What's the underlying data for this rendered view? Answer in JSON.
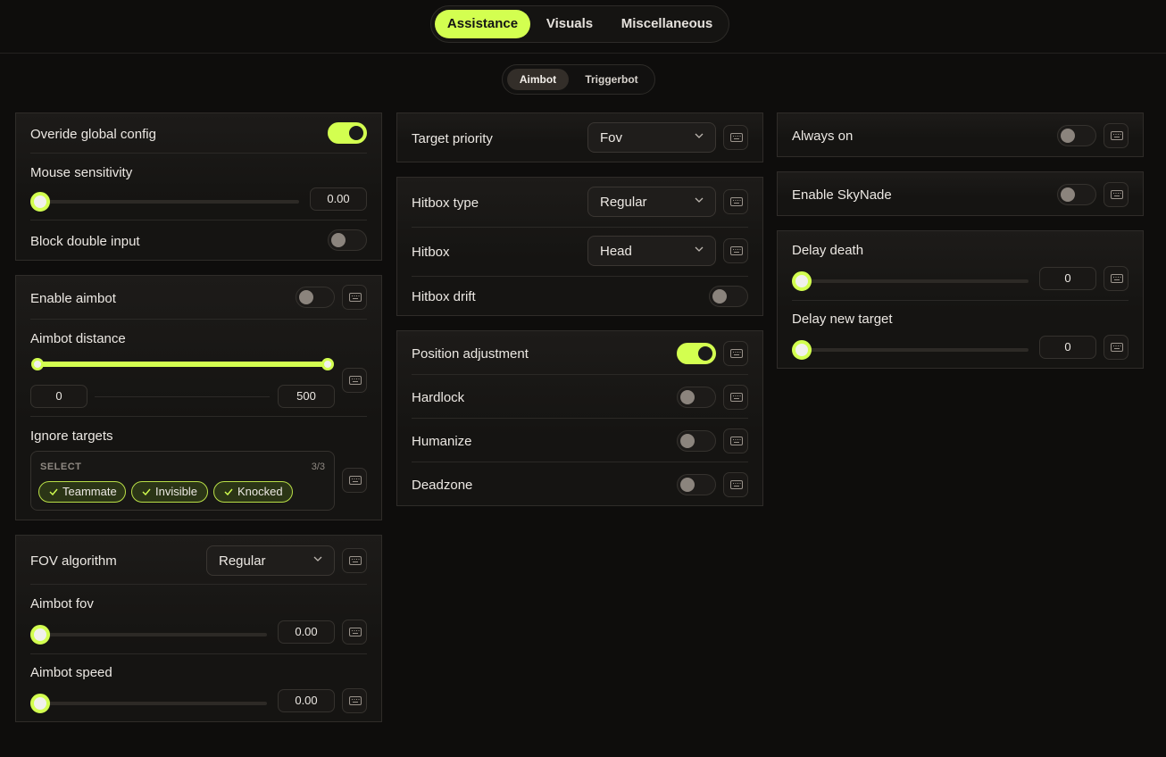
{
  "colors": {
    "accent": "#d3ff50",
    "background": "#0e0d0c",
    "panel": "#1b1917"
  },
  "main_tabs": [
    "Assistance",
    "Visuals",
    "Miscellaneous"
  ],
  "sub_tabs": [
    "Aimbot",
    "Triggerbot"
  ],
  "col1": {
    "override_label": "Overide global config",
    "override_on": true,
    "mouse_sensitivity_label": "Mouse sensitivity",
    "mouse_sensitivity_value": "0.00",
    "block_double_input_label": "Block double input",
    "block_double_input_on": false,
    "enable_aimbot_label": "Enable aimbot",
    "enable_aimbot_on": false,
    "aimbot_distance_label": "Aimbot distance",
    "aimbot_distance_min": "0",
    "aimbot_distance_max": "500",
    "ignore_targets_label": "Ignore targets",
    "select_label": "SELECT",
    "select_count": "3/3",
    "targets": [
      "Teammate",
      "Invisible",
      "Knocked"
    ],
    "fov_algorithm_label": "FOV algorithm",
    "fov_algorithm_value": "Regular",
    "aimbot_fov_label": "Aimbot fov",
    "aimbot_fov_value": "0.00",
    "aimbot_speed_label": "Aimbot speed",
    "aimbot_speed_value": "0.00"
  },
  "col2": {
    "target_priority_label": "Target priority",
    "target_priority_value": "Fov",
    "hitbox_type_label": "Hitbox type",
    "hitbox_type_value": "Regular",
    "hitbox_label": "Hitbox",
    "hitbox_value": "Head",
    "hitbox_drift_label": "Hitbox drift",
    "hitbox_drift_on": false,
    "position_adjustment_label": "Position adjustment",
    "position_adjustment_on": true,
    "hardlock_label": "Hardlock",
    "hardlock_on": false,
    "humanize_label": "Humanize",
    "humanize_on": false,
    "deadzone_label": "Deadzone",
    "deadzone_on": false
  },
  "col3": {
    "always_on_label": "Always on",
    "always_on_on": false,
    "enable_skynade_label": "Enable SkyNade",
    "enable_skynade_on": false,
    "delay_death_label": "Delay death",
    "delay_death_value": "0",
    "delay_new_target_label": "Delay new target",
    "delay_new_target_value": "0"
  }
}
